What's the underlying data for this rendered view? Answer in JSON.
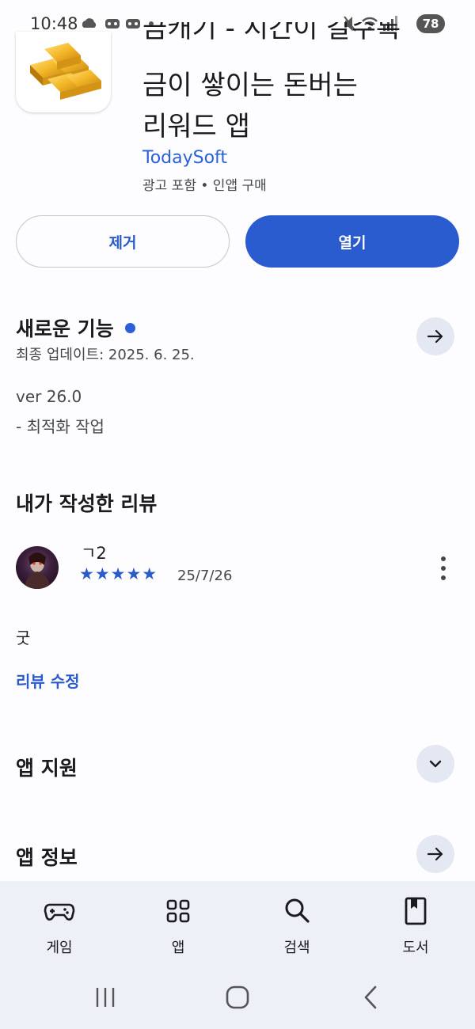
{
  "status_bar": {
    "time": "10:48",
    "left_icons": "☁ ◉ ◉ •",
    "right_icons": "🔇 📶 ▮",
    "battery": "78"
  },
  "app": {
    "title_lines": [
      "금캐기 - 시간이 갈수록",
      "금이 쌓이는 돈버는",
      "리워드 앱"
    ],
    "developer": "TodaySoft",
    "meta": "광고 포함 • 인앱 구매",
    "icon": "gold-bars-icon"
  },
  "actions": {
    "remove_label": "제거",
    "open_label": "열기"
  },
  "whats_new": {
    "title": "새로운 기능",
    "updated": "최종 업데이트: 2025. 6. 25.",
    "version": "ver 26.0",
    "notes": "- 최적화 작업"
  },
  "my_review": {
    "title": "내가 작성한 리뷰",
    "reviewer": "ㄱ2",
    "stars": "★★★★★",
    "rating": 5,
    "date": "25/7/26",
    "text": "굿",
    "edit_label": "리뷰 수정"
  },
  "app_support": {
    "title": "앱 지원"
  },
  "app_info": {
    "title": "앱 정보"
  },
  "bottom_nav": {
    "items": [
      {
        "label": "게임",
        "icon": "gamepad-icon"
      },
      {
        "label": "앱",
        "icon": "apps-grid-icon"
      },
      {
        "label": "검색",
        "icon": "search-icon"
      },
      {
        "label": "도서",
        "icon": "book-icon"
      }
    ]
  },
  "colors": {
    "accent": "#2a5ccf",
    "link": "#2b5bc9",
    "background": "#fdfcff",
    "nav_background": "#eef0f7"
  }
}
